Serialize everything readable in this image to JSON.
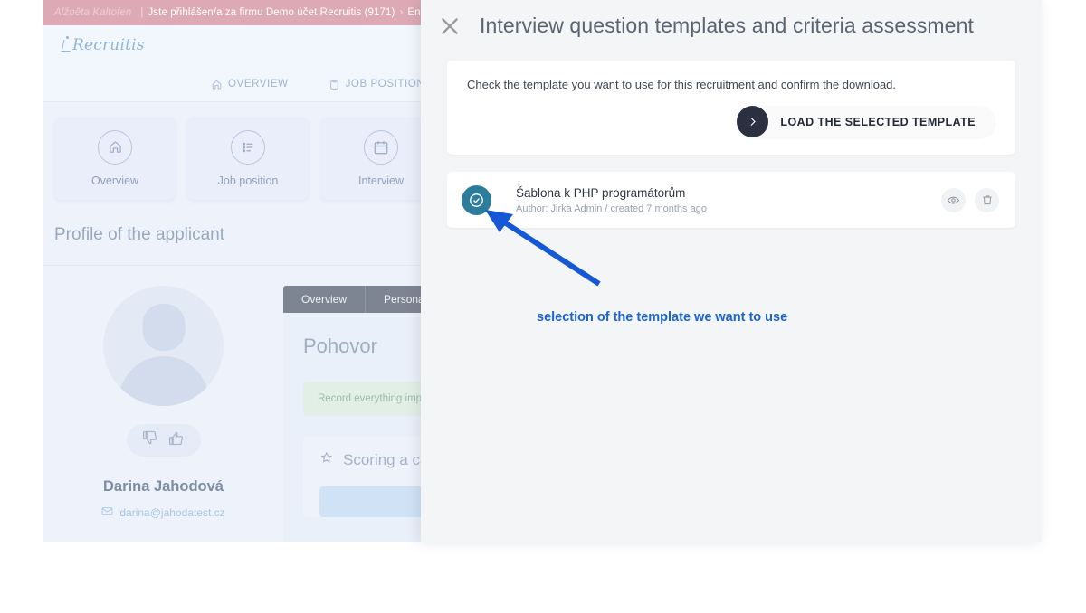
{
  "background_app": {
    "topbar": {
      "user": "Alžběta Kaltofen",
      "separator": "|",
      "logged_in_text": "Jste přihlášen/a za firmu Demo účet Recruitis (9171)",
      "chevron": "›",
      "language": "English A"
    },
    "logo_text": "Recruitis",
    "nav": [
      {
        "label": "OVERVIEW",
        "icon": "home-icon"
      },
      {
        "label": "JOB POSITION",
        "icon": "clipboard-icon",
        "caret": "⌄"
      }
    ],
    "tiles": [
      {
        "label": "Overview",
        "icon": "home-icon"
      },
      {
        "label": "Job position",
        "icon": "list-icon"
      },
      {
        "label": "Interview",
        "icon": "calendar-icon"
      }
    ],
    "section_title": "Profile of the applicant",
    "applicant": {
      "name": "Darina Jahodová",
      "email": "darina@jahodatest.cz",
      "email_icon": "envelope-icon",
      "thumb_down_icon": "thumbs-down-icon",
      "thumb_up_icon": "thumbs-up-icon"
    },
    "tabs": [
      {
        "label": "Overview"
      },
      {
        "label": "Personal data"
      }
    ],
    "panel": {
      "heading": "Pohovor",
      "note": "Record everything importa",
      "score_heading": "Scoring a candid",
      "score_icon": "star-icon"
    }
  },
  "overlay": {
    "close_icon": "close-icon",
    "title": "Interview question templates and criteria assessment",
    "instruction": "Check the template you want to use for this recruitment and confirm the download.",
    "load_button": {
      "label": "LOAD THE SELECTED TEMPLATE",
      "icon": "chevron-right-icon",
      "circle_color": "#2b3040"
    },
    "template": {
      "selected": true,
      "check_icon": "check-circle-icon",
      "check_color": "#2c7d9c",
      "name": "Šablona k PHP programátorům",
      "meta": "Author: Jirka Admin / created 7 months ago",
      "actions": [
        {
          "name": "preview",
          "icon": "eye-icon"
        },
        {
          "name": "delete",
          "icon": "trash-icon"
        }
      ]
    }
  },
  "annotation": {
    "text": "selection of the template we want to use",
    "color": "#1a62d8",
    "arrow_icon": "arrow-pointer"
  }
}
